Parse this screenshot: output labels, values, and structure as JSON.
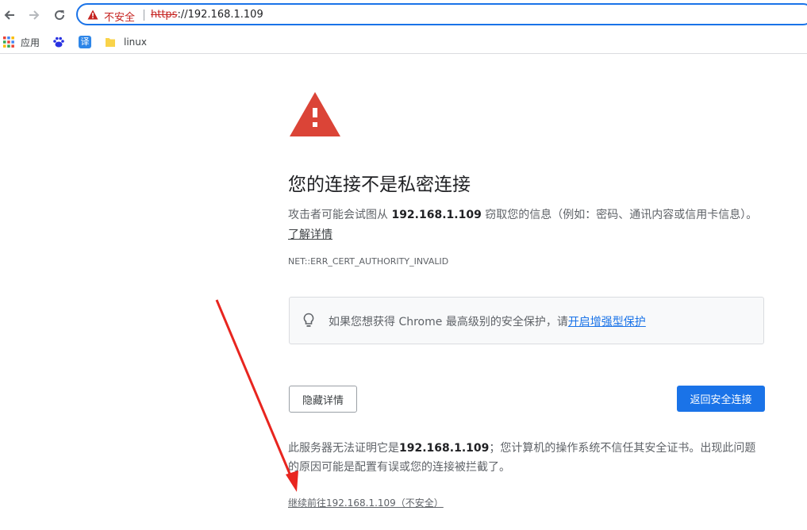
{
  "omnibox": {
    "security_label": "不安全",
    "url_scheme": "https",
    "url_rest": "://192.168.1.109"
  },
  "bookmarks": [
    {
      "label": "应用",
      "icon": "apps-grid-icon"
    },
    {
      "label": "",
      "icon": "baidu-paw-icon"
    },
    {
      "label": "",
      "icon": "translate-icon",
      "glyph": "译"
    },
    {
      "label": "linux",
      "icon": "folder-icon"
    }
  ],
  "interstitial": {
    "heading": "您的连接不是私密连接",
    "desc_prefix": "攻击者可能会试图从 ",
    "desc_host": "192.168.1.109",
    "desc_suffix": " 窃取您的信息（例如：密码、通讯内容或信用卡信息）。",
    "learn_more": "了解详情",
    "error_code": "NET::ERR_CERT_AUTHORITY_INVALID",
    "tip_text": "如果您想获得 Chrome 最高级别的安全保护，请",
    "tip_link": "开启增强型保护",
    "hide_details_button": "隐藏详情",
    "back_button": "返回安全连接",
    "explain_prefix": "此服务器无法证明它是",
    "explain_host": "192.168.1.109",
    "explain_suffix": "；您计算机的操作系统不信任其安全证书。出现此问题的原因可能是配置有误或您的连接被拦截了。",
    "proceed_link": "继续前往192.168.1.109（不安全）"
  },
  "colors": {
    "warning_red": "#db4437",
    "accent_blue": "#1a73e8",
    "annotation_arrow": "#e8251f"
  }
}
